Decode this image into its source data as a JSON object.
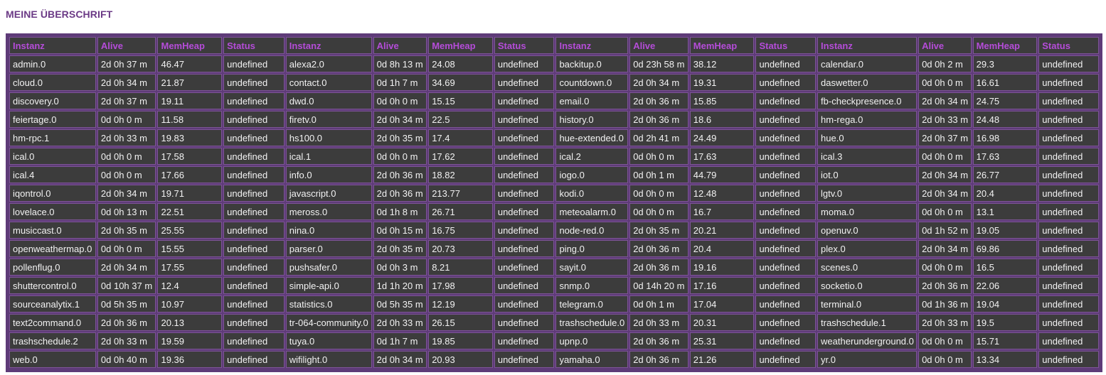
{
  "page": {
    "heading": "MEINE ÜBERSCHRIFT"
  },
  "table": {
    "headers": [
      "Instanz",
      "Alive",
      "MemHeap",
      "Status",
      "Instanz",
      "Alive",
      "MemHeap",
      "Status",
      "Instanz",
      "Alive",
      "MemHeap",
      "Status",
      "Instanz",
      "Alive",
      "MemHeap",
      "Status"
    ],
    "rows": [
      [
        "admin.0",
        "2d 0h 37 m",
        "46.47",
        "undefined",
        "alexa2.0",
        "0d 8h 13 m",
        "24.08",
        "undefined",
        "backitup.0",
        "0d 23h 58 m",
        "38.12",
        "undefined",
        "calendar.0",
        "0d 0h 2 m",
        "29.3",
        "undefined"
      ],
      [
        "cloud.0",
        "2d 0h 34 m",
        "21.87",
        "undefined",
        "contact.0",
        "0d 1h 7 m",
        "34.69",
        "undefined",
        "countdown.0",
        "2d 0h 34 m",
        "19.31",
        "undefined",
        "daswetter.0",
        "0d 0h 0 m",
        "16.61",
        "undefined"
      ],
      [
        "discovery.0",
        "2d 0h 37 m",
        "19.11",
        "undefined",
        "dwd.0",
        "0d 0h 0 m",
        "15.15",
        "undefined",
        "email.0",
        "2d 0h 36 m",
        "15.85",
        "undefined",
        "fb-checkpresence.0",
        "2d 0h 34 m",
        "24.75",
        "undefined"
      ],
      [
        "feiertage.0",
        "0d 0h 0 m",
        "11.58",
        "undefined",
        "firetv.0",
        "2d 0h 34 m",
        "22.5",
        "undefined",
        "history.0",
        "2d 0h 36 m",
        "18.6",
        "undefined",
        "hm-rega.0",
        "2d 0h 33 m",
        "24.48",
        "undefined"
      ],
      [
        "hm-rpc.1",
        "2d 0h 33 m",
        "19.83",
        "undefined",
        "hs100.0",
        "2d 0h 35 m",
        "17.4",
        "undefined",
        "hue-extended.0",
        "0d 2h 41 m",
        "24.49",
        "undefined",
        "hue.0",
        "2d 0h 37 m",
        "16.98",
        "undefined"
      ],
      [
        "ical.0",
        "0d 0h 0 m",
        "17.58",
        "undefined",
        "ical.1",
        "0d 0h 0 m",
        "17.62",
        "undefined",
        "ical.2",
        "0d 0h 0 m",
        "17.63",
        "undefined",
        "ical.3",
        "0d 0h 0 m",
        "17.63",
        "undefined"
      ],
      [
        "ical.4",
        "0d 0h 0 m",
        "17.66",
        "undefined",
        "info.0",
        "2d 0h 36 m",
        "18.82",
        "undefined",
        "iogo.0",
        "0d 0h 1 m",
        "44.79",
        "undefined",
        "iot.0",
        "2d 0h 34 m",
        "26.77",
        "undefined"
      ],
      [
        "iqontrol.0",
        "2d 0h 34 m",
        "19.71",
        "undefined",
        "javascript.0",
        "2d 0h 36 m",
        "213.77",
        "undefined",
        "kodi.0",
        "0d 0h 0 m",
        "12.48",
        "undefined",
        "lgtv.0",
        "2d 0h 34 m",
        "20.4",
        "undefined"
      ],
      [
        "lovelace.0",
        "0d 0h 13 m",
        "22.51",
        "undefined",
        "meross.0",
        "0d 1h 8 m",
        "26.71",
        "undefined",
        "meteoalarm.0",
        "0d 0h 0 m",
        "16.7",
        "undefined",
        "moma.0",
        "0d 0h 0 m",
        "13.1",
        "undefined"
      ],
      [
        "musiccast.0",
        "2d 0h 35 m",
        "25.55",
        "undefined",
        "nina.0",
        "0d 0h 15 m",
        "16.75",
        "undefined",
        "node-red.0",
        "2d 0h 35 m",
        "20.21",
        "undefined",
        "openuv.0",
        "0d 1h 52 m",
        "19.05",
        "undefined"
      ],
      [
        "openweathermap.0",
        "0d 0h 0 m",
        "15.55",
        "undefined",
        "parser.0",
        "2d 0h 35 m",
        "20.73",
        "undefined",
        "ping.0",
        "2d 0h 36 m",
        "20.4",
        "undefined",
        "plex.0",
        "2d 0h 34 m",
        "69.86",
        "undefined"
      ],
      [
        "pollenflug.0",
        "2d 0h 34 m",
        "17.55",
        "undefined",
        "pushsafer.0",
        "0d 0h 3 m",
        "8.21",
        "undefined",
        "sayit.0",
        "2d 0h 36 m",
        "19.16",
        "undefined",
        "scenes.0",
        "0d 0h 0 m",
        "16.5",
        "undefined"
      ],
      [
        "shuttercontrol.0",
        "0d 10h 37 m",
        "12.4",
        "undefined",
        "simple-api.0",
        "1d 1h 20 m",
        "17.98",
        "undefined",
        "snmp.0",
        "0d 14h 20 m",
        "17.16",
        "undefined",
        "socketio.0",
        "2d 0h 36 m",
        "22.06",
        "undefined"
      ],
      [
        "sourceanalytix.1",
        "0d 5h 35 m",
        "10.97",
        "undefined",
        "statistics.0",
        "0d 5h 35 m",
        "12.19",
        "undefined",
        "telegram.0",
        "0d 0h 1 m",
        "17.04",
        "undefined",
        "terminal.0",
        "0d 1h 36 m",
        "19.04",
        "undefined"
      ],
      [
        "text2command.0",
        "2d 0h 36 m",
        "20.13",
        "undefined",
        "tr-064-community.0",
        "2d 0h 33 m",
        "26.15",
        "undefined",
        "trashschedule.0",
        "2d 0h 33 m",
        "20.31",
        "undefined",
        "trashschedule.1",
        "2d 0h 33 m",
        "19.5",
        "undefined"
      ],
      [
        "trashschedule.2",
        "2d 0h 33 m",
        "19.59",
        "undefined",
        "tuya.0",
        "0d 1h 7 m",
        "19.85",
        "undefined",
        "upnp.0",
        "2d 0h 36 m",
        "25.31",
        "undefined",
        "weatherunderground.0",
        "0d 0h 0 m",
        "15.71",
        "undefined"
      ],
      [
        "web.0",
        "0d 0h 40 m",
        "19.36",
        "undefined",
        "wifilight.0",
        "2d 0h 34 m",
        "20.93",
        "undefined",
        "yamaha.0",
        "2d 0h 36 m",
        "21.26",
        "undefined",
        "yr.0",
        "0d 0h 0 m",
        "13.34",
        "undefined"
      ]
    ]
  }
}
